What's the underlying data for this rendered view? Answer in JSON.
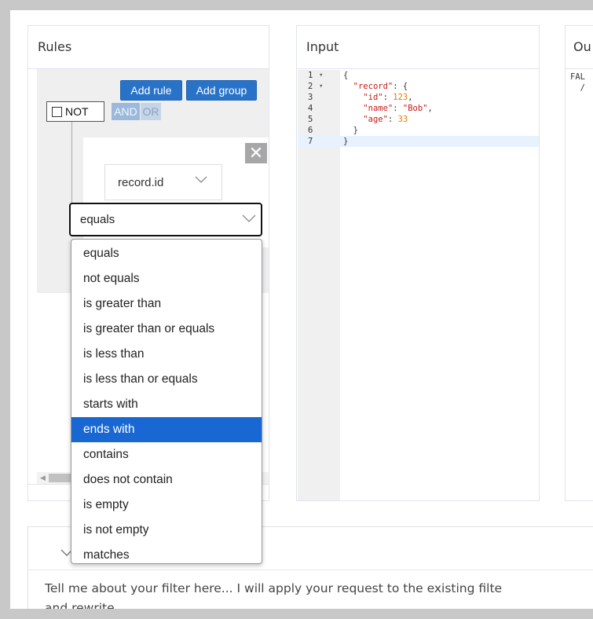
{
  "panels": {
    "rules_title": "Rules",
    "input_title": "Input",
    "output_title": "Ou"
  },
  "rules": {
    "add_rule_label": "Add rule",
    "add_group_label": "Add group",
    "not_label": "NOT",
    "and_label": "AND",
    "or_label": "OR",
    "remove_symbol": "✕",
    "field_value": "record.id",
    "operator_value": "equals"
  },
  "operator_options": [
    "equals",
    "not equals",
    "is greater than",
    "is greater than or equals",
    "is less than",
    "is less than or equals",
    "starts with",
    "ends with",
    "contains",
    "does not contain",
    "is empty",
    "is not empty",
    "matches"
  ],
  "highlighted_option": "ends with",
  "editor": {
    "lines": [
      {
        "num": "1",
        "fold": "▾",
        "code": "{"
      },
      {
        "num": "2",
        "fold": "▾",
        "code": "  \"record\": {"
      },
      {
        "num": "3",
        "fold": "",
        "code": "    \"id\": 123,"
      },
      {
        "num": "4",
        "fold": "",
        "code": "    \"name\": \"Bob\","
      },
      {
        "num": "5",
        "fold": "",
        "code": "    \"age\": 33"
      },
      {
        "num": "6",
        "fold": "",
        "code": "  }"
      },
      {
        "num": "7",
        "fold": "",
        "code": "}"
      }
    ]
  },
  "output": {
    "line1": "FAL",
    "line2": "  /"
  },
  "assistant": {
    "prompt_line1": "Tell me about your filter here... I will apply your request to the existing filte",
    "prompt_line2": "and rewrite"
  },
  "colors": {
    "accent": "#2873c8",
    "selected_option": "#1967d2"
  }
}
